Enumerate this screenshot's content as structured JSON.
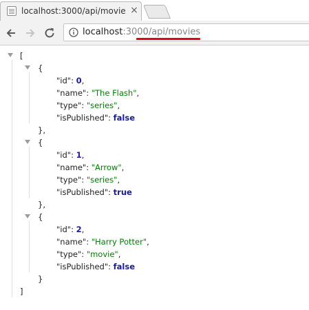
{
  "tab": {
    "title": "localhost:3000/api/movie",
    "close": "×"
  },
  "address_bar": {
    "host": "localhost",
    "path": ":3000/api/movies"
  },
  "json": {
    "open_bracket": "[",
    "close_bracket": "]",
    "open_brace": "{",
    "close_brace_comma": "},",
    "close_brace": "}",
    "keys": {
      "id": "\"id\"",
      "name": "\"name\"",
      "type": "\"type\"",
      "isPublished": "\"isPublished\""
    },
    "items": [
      {
        "id": "0",
        "name": "\"The Flash\"",
        "type": "\"series\"",
        "isPublished": "false"
      },
      {
        "id": "1",
        "name": "\"Arrow\"",
        "type": "\"series\"",
        "isPublished": "true"
      },
      {
        "id": "2",
        "name": "\"Harry Potter\"",
        "type": "\"movie\"",
        "isPublished": "false"
      }
    ]
  }
}
